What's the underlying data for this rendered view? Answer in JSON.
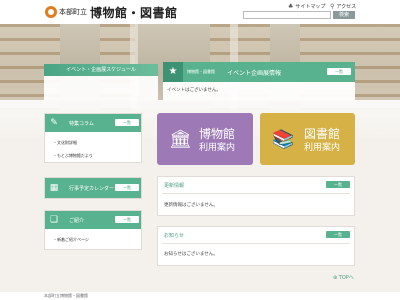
{
  "header": {
    "town": "本部町立",
    "title": "博物館・図書館",
    "sitemap": "サイトマップ",
    "access": "アクセス",
    "search_button": "検索"
  },
  "hero": {
    "left_panel_title": "イベント・企画展スケジュール",
    "right_small": "博物館・図書館",
    "right_title": "イベント企画展情報",
    "list_label": "一覧",
    "right_body": "イベントはございません。"
  },
  "column": {
    "title": "特集コラム",
    "list_label": "一覧",
    "items": [
      "文化財詳細",
      "もとぶ博物館だより"
    ]
  },
  "calendar": {
    "title": "行事予定カレンダー",
    "list_label": "一覧"
  },
  "intro": {
    "title": "ご紹介",
    "list_label": "一覧",
    "items": [
      "新着ご紹介ページ"
    ]
  },
  "museum_guide": {
    "line1": "博物館",
    "line2": "利用案内",
    "color": "#9d7ab6"
  },
  "library_guide": {
    "line1": "図書館",
    "line2": "利用案内",
    "color": "#d6b145"
  },
  "updates": {
    "title": "更新情報",
    "list_label": "一覧",
    "body": "更新情報はございません。"
  },
  "notices": {
    "title": "お知らせ",
    "list_label": "一覧",
    "body": "お知らせはございません。"
  },
  "top_link": "TOPへ",
  "footer": "本部町立博物館・図書館",
  "colors": {
    "accent": "#58b28f",
    "accent_dark": "#3d9273"
  }
}
